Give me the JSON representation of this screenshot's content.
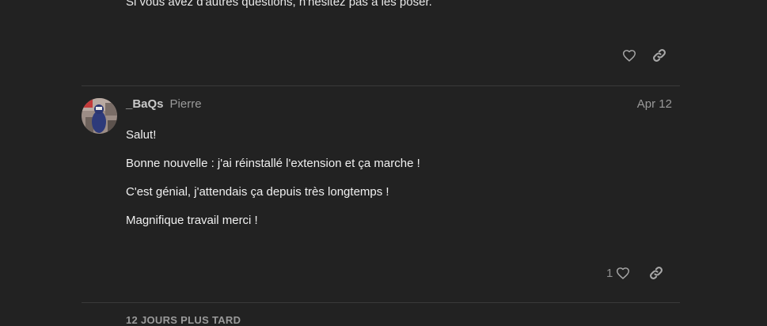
{
  "previous_post": {
    "last_line": "Si vous avez d'autres questions, n'hésitez pas à les poser."
  },
  "post": {
    "username": "_BaQs",
    "full_name": "Pierre",
    "date": "Apr 12",
    "body": [
      "Salut!",
      "Bonne nouvelle : j'ai réinstallé l'extension et ça marche !",
      "C'est génial, j'attendais ça depuis très longtemps !",
      "Magnifique travail merci !"
    ],
    "like_count": "1"
  },
  "time_gap": "12 JOURS PLUS TARD",
  "icons": {
    "like": "heart-icon",
    "share": "link-icon"
  },
  "colors": {
    "background": "#222222",
    "text": "#f0f0f0",
    "muted": "#9a9a9a",
    "divider": "#3a3a3a"
  }
}
